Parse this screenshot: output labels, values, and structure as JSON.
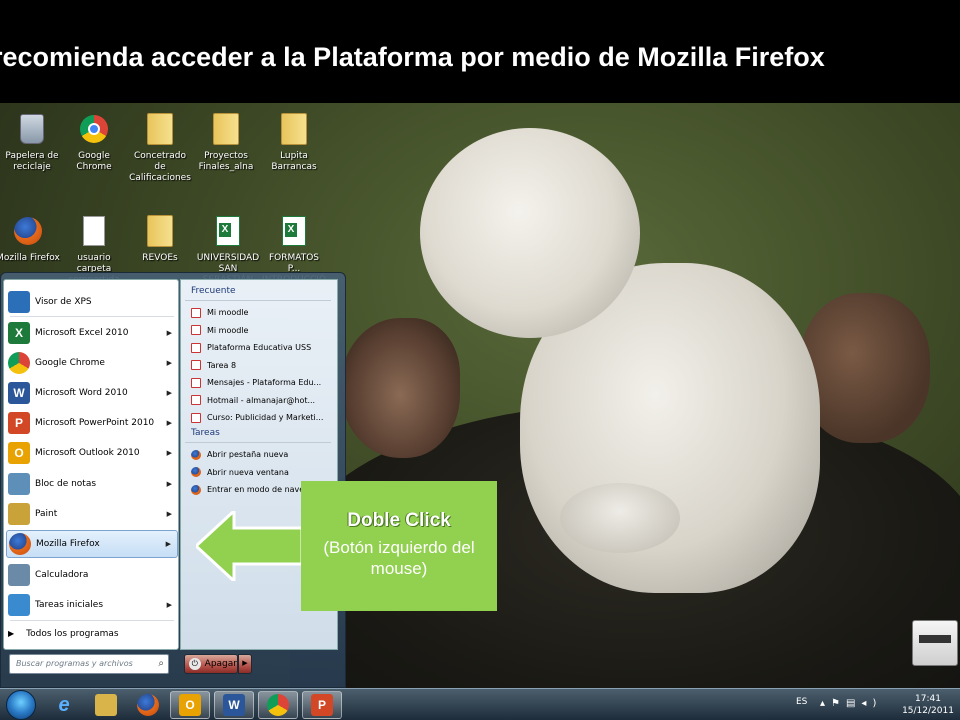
{
  "banner": {
    "text": "recomienda acceder a la Plataforma por medio de Mozilla Firefox"
  },
  "desktop_icons": [
    {
      "label": "Papelera de reciclaje",
      "icon": "recycle-bin-icon"
    },
    {
      "label": "Google Chrome",
      "icon": "chrome-icon"
    },
    {
      "label": "Concetrado de Calificaciones",
      "icon": "folder-icon"
    },
    {
      "label": "Proyectos Finales_alna",
      "icon": "folder-icon"
    },
    {
      "label": "Lupita Barrancas",
      "icon": "folder-icon"
    },
    {
      "label": "Mozilla Firefox",
      "icon": "firefox-icon"
    },
    {
      "label": "usuario carpeta compartida",
      "icon": "document-icon"
    },
    {
      "label": "REVOEs",
      "icon": "folder-icon"
    },
    {
      "label": "UNIVERSIDAD SAN SEBASTIÁN",
      "icon": "excel-file-icon"
    },
    {
      "label": "FORMATOS P... INTRODUCCIÓ...",
      "icon": "excel-file-icon"
    }
  ],
  "start_menu": {
    "programs": [
      {
        "label": "Visor de XPS",
        "icon": "xps-viewer-icon",
        "color": "#2a6fb8",
        "glyph": "",
        "submenu": false
      },
      {
        "label": "Microsoft Excel 2010",
        "icon": "excel-icon",
        "color": "#1d7a3a",
        "glyph": "X",
        "submenu": true
      },
      {
        "label": "Google Chrome",
        "icon": "chrome-icon",
        "color": "#db4437",
        "glyph": "",
        "submenu": true
      },
      {
        "label": "Microsoft Word 2010",
        "icon": "word-icon",
        "color": "#2b579a",
        "glyph": "W",
        "submenu": true
      },
      {
        "label": "Microsoft PowerPoint 2010",
        "icon": "powerpoint-icon",
        "color": "#d24726",
        "glyph": "P",
        "submenu": true
      },
      {
        "label": "Microsoft Outlook 2010",
        "icon": "outlook-icon",
        "color": "#e8a202",
        "glyph": "O",
        "submenu": true
      },
      {
        "label": "Bloc de notas",
        "icon": "notepad-icon",
        "color": "#5e8fb8",
        "glyph": "",
        "submenu": true
      },
      {
        "label": "Paint",
        "icon": "paint-icon",
        "color": "#c9a23a",
        "glyph": "",
        "submenu": true
      },
      {
        "label": "Mozilla Firefox",
        "icon": "firefox-icon",
        "color": "#e56a1a",
        "glyph": "",
        "submenu": true
      },
      {
        "label": "Calculadora",
        "icon": "calculator-icon",
        "color": "#6a8aa8",
        "glyph": "",
        "submenu": false
      },
      {
        "label": "Tareas iniciales",
        "icon": "getting-started-icon",
        "color": "#3a8ad0",
        "glyph": "",
        "submenu": true
      }
    ],
    "all_programs": "Todos los programas",
    "search_placeholder": "Buscar programas y archivos",
    "shutdown_label": "Apagar",
    "jump_list": {
      "frequent_header": "Frecuente",
      "frequent": [
        "Mi moodle",
        "Mi moodle",
        "Plataforma Educativa USS",
        "Tarea 8",
        "Mensajes - Plataforma Edu...",
        "Hotmail - almanajar@hot...",
        "Curso: Publicidad y Marketi..."
      ],
      "tasks_header": "Tareas",
      "tasks": [
        "Abrir pestaña nueva",
        "Abrir nueva ventana",
        "Entrar en modo de navega..."
      ]
    }
  },
  "callout": {
    "title": "Doble Click",
    "subtitle": "(Botón izquierdo del mouse)",
    "color": "#92d050"
  },
  "taskbar": {
    "buttons": [
      {
        "icon": "internet-explorer-icon",
        "color": "#3a8ad0",
        "glyph": "e"
      },
      {
        "icon": "file-explorer-icon",
        "color": "#d9b44a",
        "glyph": ""
      },
      {
        "icon": "firefox-icon",
        "color": "#e56a1a",
        "glyph": ""
      },
      {
        "icon": "outlook-icon",
        "color": "#e8a202",
        "glyph": "O"
      },
      {
        "icon": "word-icon",
        "color": "#2b579a",
        "glyph": "W"
      },
      {
        "icon": "chrome-icon",
        "color": "#db4437",
        "glyph": ""
      },
      {
        "icon": "powerpoint-icon",
        "color": "#d24726",
        "glyph": "P"
      }
    ],
    "language": "ES",
    "time": "17:41",
    "date": "15/12/2011"
  }
}
